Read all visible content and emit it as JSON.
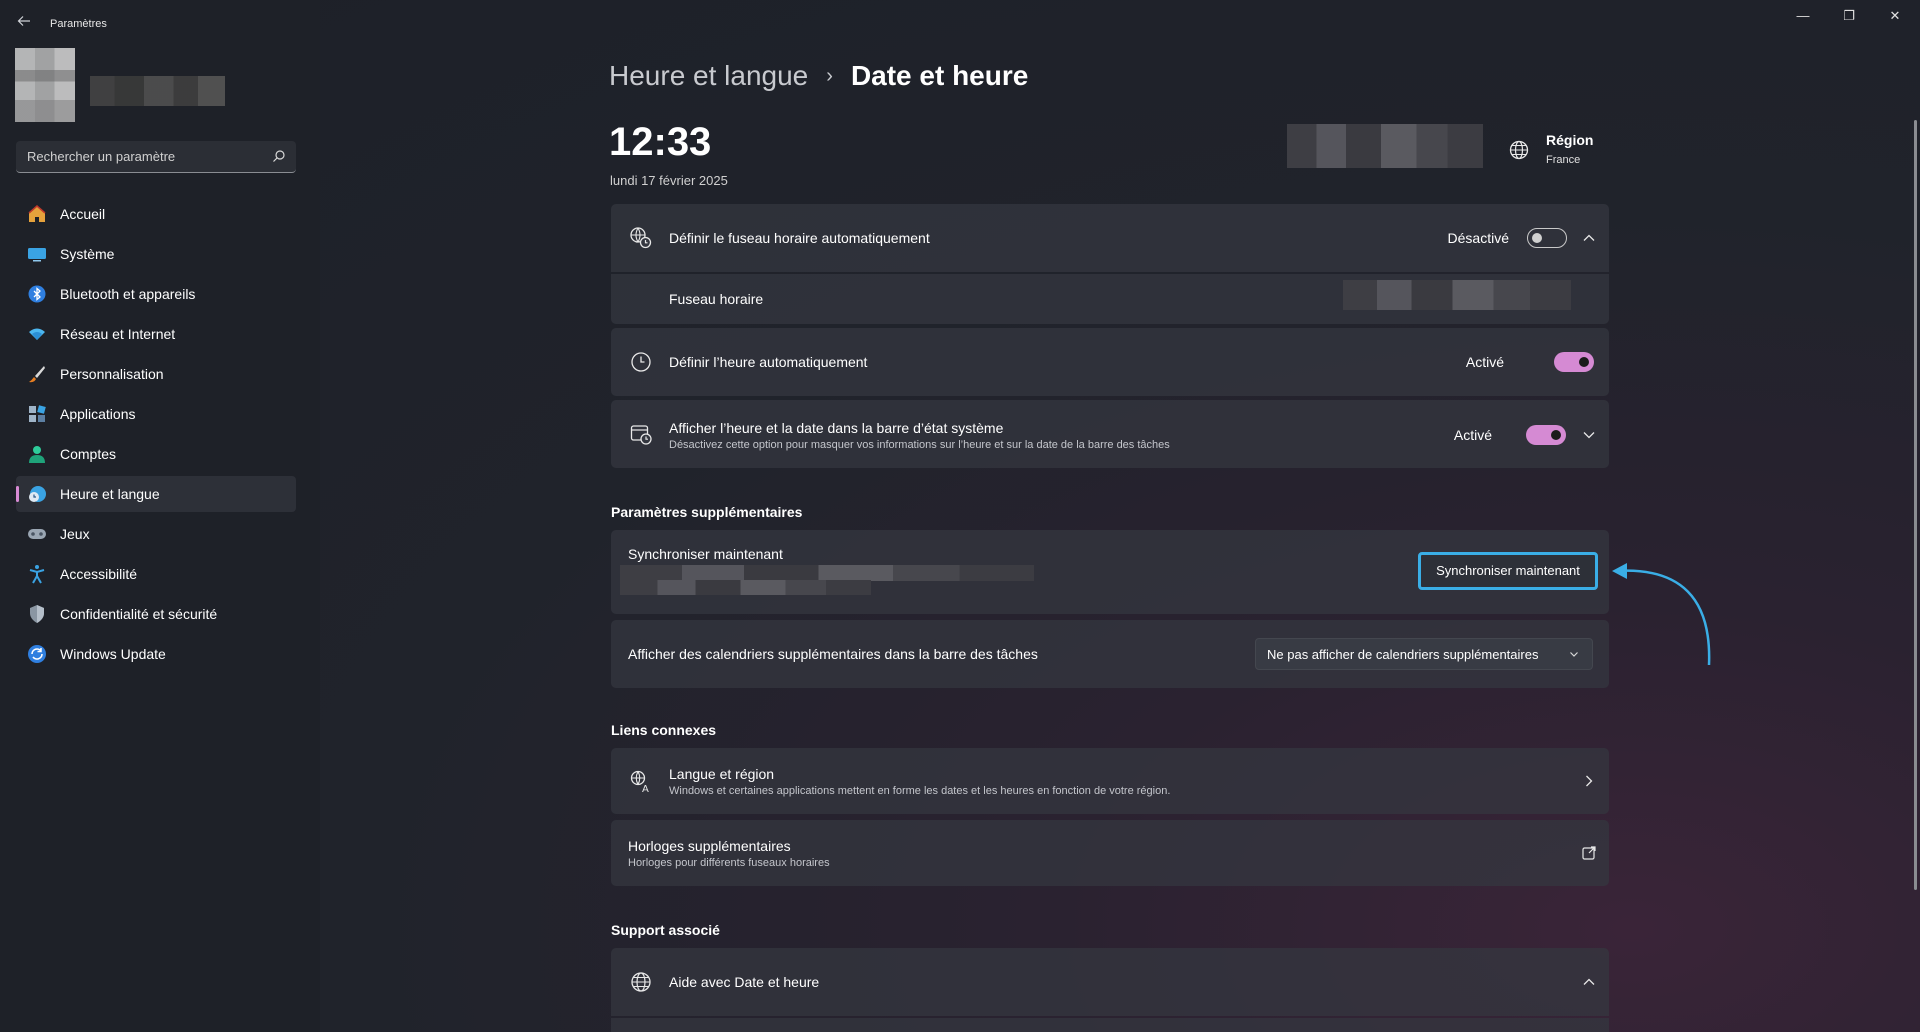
{
  "window": {
    "title": "Paramètres",
    "controls": {
      "minimize": "—",
      "maximize": "❐",
      "close": "✕"
    }
  },
  "search": {
    "placeholder": "Rechercher un paramètre"
  },
  "sidebar": {
    "items": [
      {
        "label": "Accueil",
        "icon": "home-icon"
      },
      {
        "label": "Système",
        "icon": "system-icon"
      },
      {
        "label": "Bluetooth et appareils",
        "icon": "bluetooth-icon"
      },
      {
        "label": "Réseau et Internet",
        "icon": "wifi-icon"
      },
      {
        "label": "Personnalisation",
        "icon": "brush-icon"
      },
      {
        "label": "Applications",
        "icon": "apps-icon"
      },
      {
        "label": "Comptes",
        "icon": "account-icon"
      },
      {
        "label": "Heure et langue",
        "icon": "time-language-icon",
        "active": true
      },
      {
        "label": "Jeux",
        "icon": "gamepad-icon"
      },
      {
        "label": "Accessibilité",
        "icon": "accessibility-icon"
      },
      {
        "label": "Confidentialité et sécurité",
        "icon": "shield-icon"
      },
      {
        "label": "Windows Update",
        "icon": "update-icon"
      }
    ]
  },
  "header": {
    "parent": "Heure et langue",
    "separator": "›",
    "current": "Date et heure"
  },
  "clock": {
    "time": "12:33",
    "date": "lundi 17 février 2025"
  },
  "region": {
    "title": "Région",
    "value": "France"
  },
  "settings": {
    "auto_timezone": {
      "label": "Définir le fuseau horaire automatiquement",
      "state": "Désactivé",
      "on": false
    },
    "timezone": {
      "label": "Fuseau horaire"
    },
    "auto_time": {
      "label": "Définir l’heure automatiquement",
      "state": "Activé",
      "on": true
    },
    "show_time_tray": {
      "label": "Afficher l’heure et la date dans la barre d’état système",
      "sub": "Désactivez cette option pour masquer vos informations sur l’heure et sur la date de la barre des tâches",
      "state": "Activé",
      "on": true
    }
  },
  "additional": {
    "title": "Paramètres supplémentaires",
    "sync": {
      "label": "Synchroniser maintenant",
      "button": "Synchroniser maintenant"
    },
    "calendars": {
      "label": "Afficher des calendriers supplémentaires dans la barre des tâches",
      "selected": "Ne pas afficher de calendriers supplémentaires"
    }
  },
  "related": {
    "title": "Liens connexes",
    "language_region": {
      "label": "Langue et région",
      "sub": "Windows et certaines applications mettent en forme les dates et les heures en fonction de votre région."
    },
    "extra_clocks": {
      "label": "Horloges supplémentaires",
      "sub": "Horloges pour différents fuseaux horaires"
    }
  },
  "support": {
    "title": "Support associé",
    "help": {
      "label": "Aide avec Date et heure"
    }
  },
  "colors": {
    "accent": "#d58ad3",
    "highlight": "#3aaee6"
  }
}
